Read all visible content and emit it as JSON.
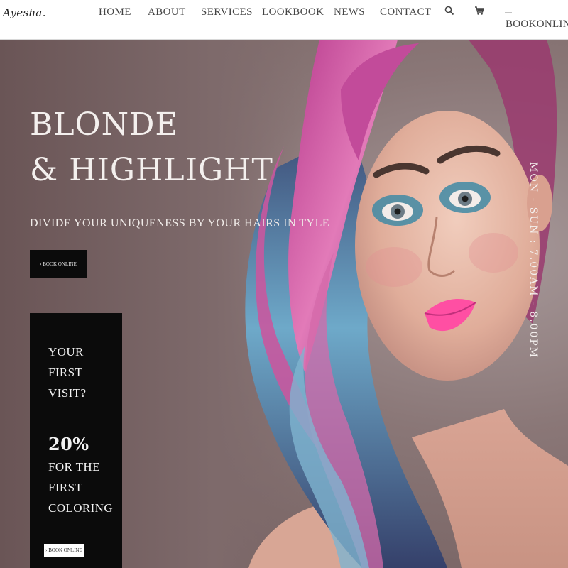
{
  "header": {
    "logo": "Ayesha.",
    "nav": {
      "home": "HOME",
      "about": "ABOUT",
      "services": "SERVICES",
      "lookbook": "LOOKBOOK",
      "news": "NEWS",
      "contact": "CONTACT"
    },
    "search_icon": "search-icon",
    "cart_icon": "cart-icon",
    "book_small": "——",
    "book_online": "BOOKONLINE"
  },
  "hero": {
    "title_line1": "BLONDE",
    "title_line2": "& HIGHLIGHT",
    "subtitle": "DIVIDE YOUR UNIQUENESS BY YOUR HAIRS IN TYLE",
    "button_label": "› BOOK ONLINE",
    "hours": "MON - SUN : 7.00AM - 8.00PM"
  },
  "promo": {
    "line1": "YOUR",
    "line2": "FIRST",
    "line3": "VISIT?",
    "percent": "20%",
    "line4": "FOR THE",
    "line5": "FIRST",
    "line6": "COLORING",
    "button_label": "› BOOK ONLINE"
  },
  "colors": {
    "hero_bg": "#8a7777",
    "promo_bg": "#0b0b0b",
    "hair_pink": "#d14a9a",
    "hair_blue": "#6fa8c8",
    "lips": "#ff4fa3"
  }
}
